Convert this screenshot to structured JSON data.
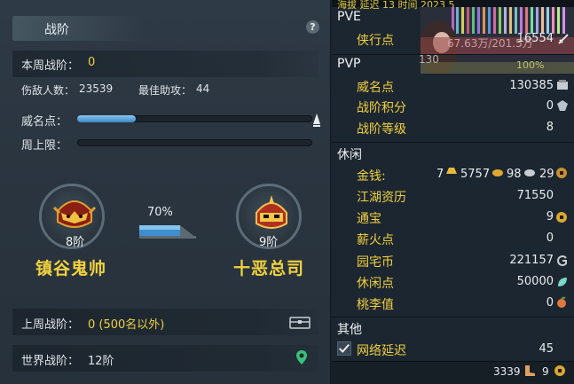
{
  "left": {
    "title": "战阶",
    "help": "?",
    "weekly_rank_label": "本周战阶：",
    "weekly_rank_value": "0",
    "kills_label": "伤敌人数：",
    "kills_value": "23539",
    "best_assist_label": "最佳助攻：",
    "best_assist_value": "44",
    "fame_label": "威名点：",
    "fame_progress": 0.25,
    "weekly_cap_label": "周上限：",
    "weekly_cap_progress": 0,
    "current_rank": {
      "level": "8阶",
      "name": "镇谷鬼帅"
    },
    "next_rank": {
      "level": "9阶",
      "name": "十恶总司"
    },
    "rank_progress": "70%",
    "last_week_label": "上周战阶：",
    "last_week_value": "0 (500名以外)",
    "world_rank_label": "世界战阶：",
    "world_rank_value": "12阶"
  },
  "right": {
    "top_strip": "海拔 延迟 13 时间 2023 5",
    "art_text_1": "67.63万/201.5万",
    "art_text_2": "130",
    "art_text_3": "100%",
    "pve": {
      "header": "PVE",
      "xingxia_label": "侠行点",
      "xingxia_value": "16554"
    },
    "pvp": {
      "header": "PVP",
      "weiming_label": "威名点",
      "weiming_value": "130385",
      "zhanjie_score_label": "战阶积分",
      "zhanjie_score_value": "0",
      "zhanjie_level_label": "战阶等级",
      "zhanjie_level_value": "8"
    },
    "leisure": {
      "header": "休闲",
      "money_label": "金钱:",
      "money_gold": "7",
      "money_silver_big": "5757",
      "money_silver": "98",
      "money_copper": "29",
      "jianghu_label": "江湖资历",
      "jianghu_value": "71550",
      "tongbao_label": "通宝",
      "tongbao_value": "9",
      "xinhuo_label": "薪火点",
      "xinhuo_value": "0",
      "yuanzhai_label": "园宅币",
      "yuanzhai_value": "221157",
      "xiuxian_label": "休闲点",
      "xiuxian_value": "50000",
      "taoli_label": "桃李值",
      "taoli_value": "0"
    },
    "other": {
      "header": "其他",
      "latency_label": "网络延迟",
      "latency_value": "45"
    },
    "bottom": {
      "count_a": "3339",
      "count_b": "9"
    }
  },
  "colors": {
    "accent_yellow": "#f0d040",
    "bar_blue": "#3a86c8",
    "panel_bg": "#2a3540"
  }
}
